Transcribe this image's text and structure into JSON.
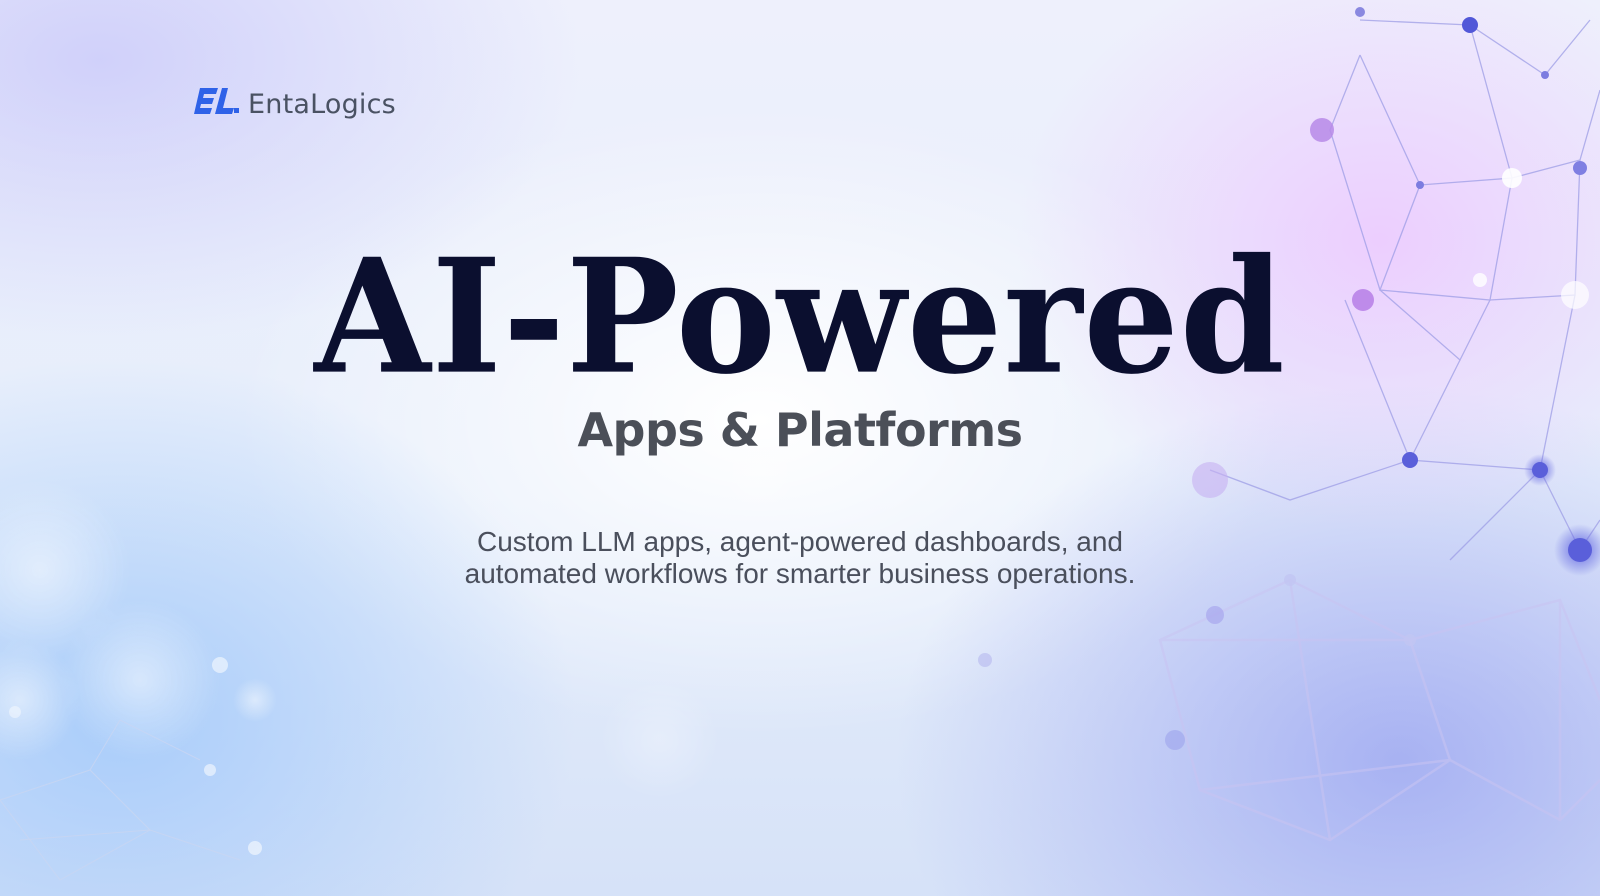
{
  "brand": {
    "name": "EntaLogics",
    "mark_color": "#2f62e8"
  },
  "hero": {
    "title": "AI-Powered",
    "subtitle": "Apps & Platforms",
    "description_lines": [
      "Custom LLM apps, agent-powered dashboards, and",
      "automated workflows for smarter business operations."
    ]
  },
  "colors": {
    "title": "#0b0f2f",
    "subtitle": "#4b4f58",
    "description": "#4a4f5c",
    "network_nodes": "#6b6fe0",
    "network_glow": "#b989f0"
  }
}
